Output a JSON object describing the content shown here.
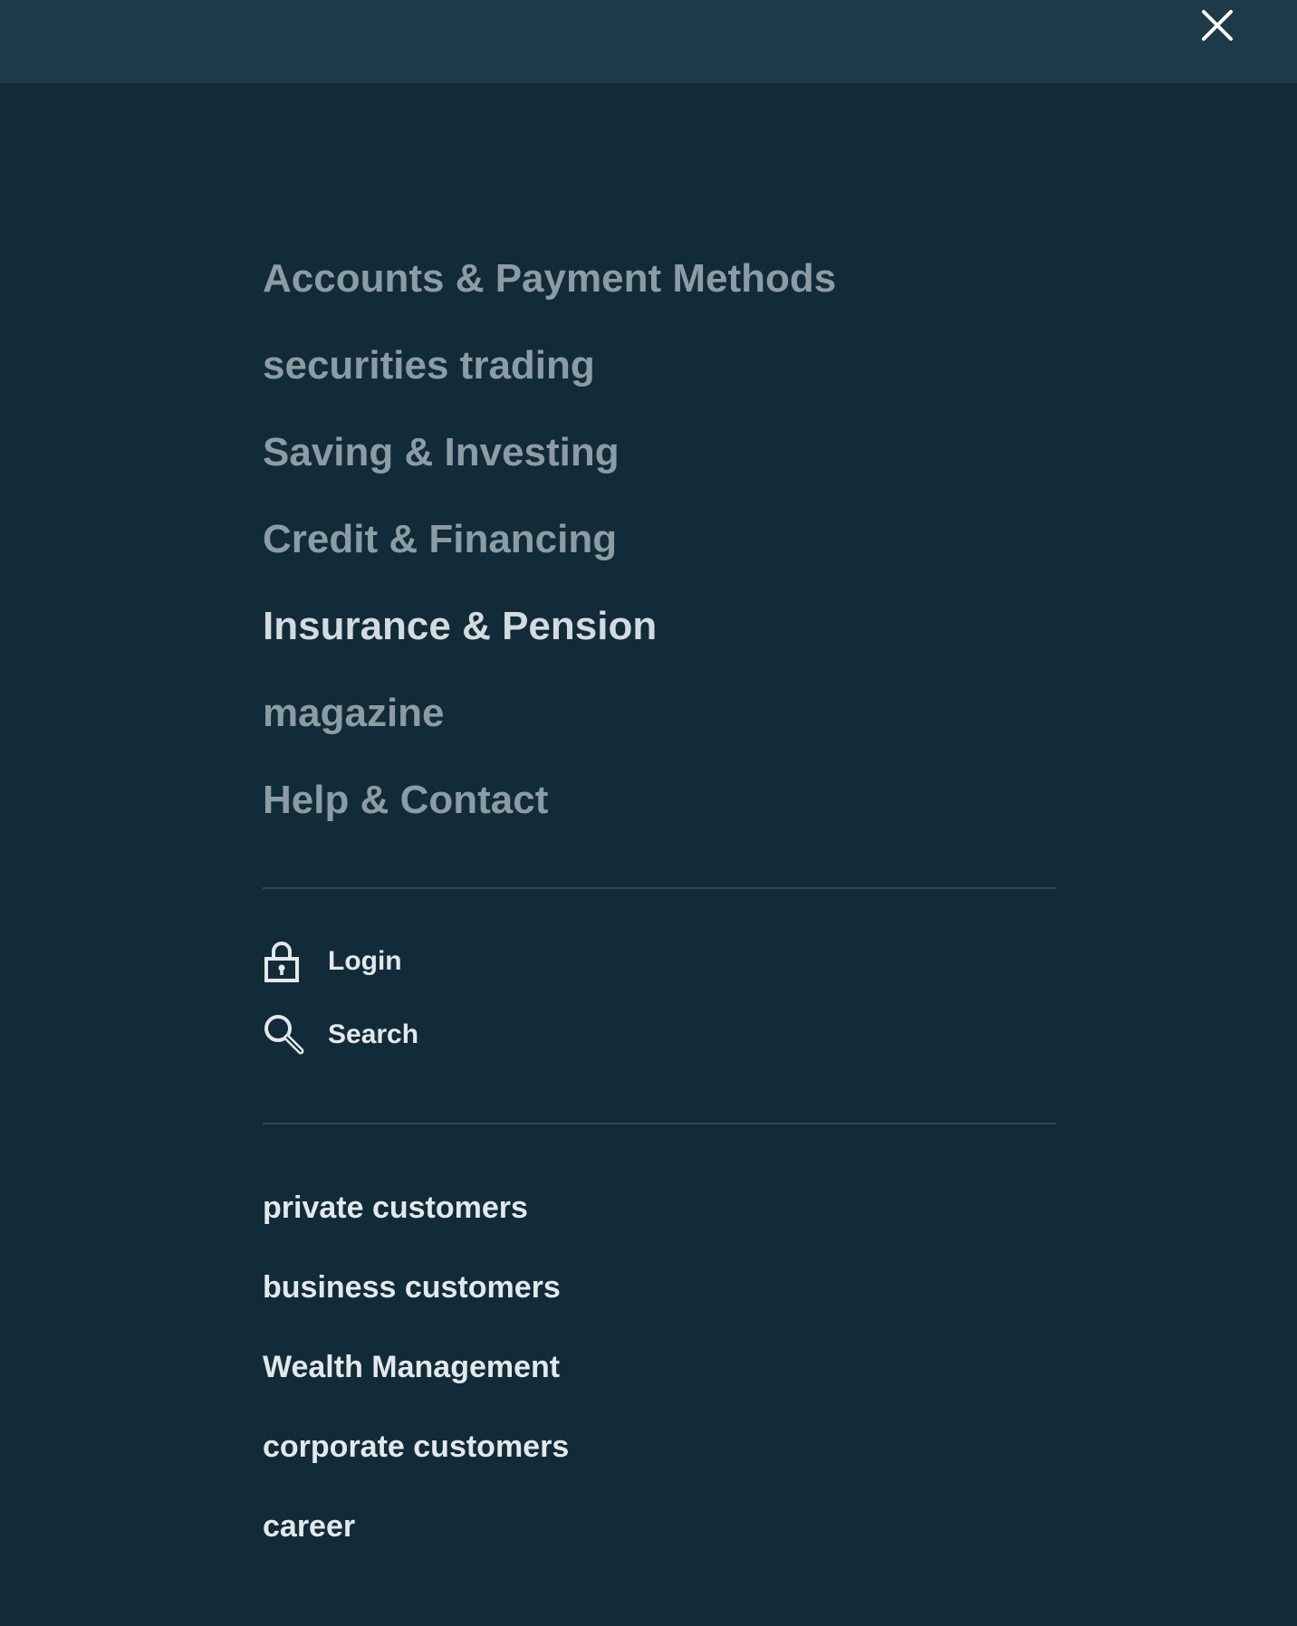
{
  "header": {
    "close_icon": "close-icon",
    "close_label": "Close menu"
  },
  "primary_nav": [
    {
      "label": "Accounts & Payment Methods",
      "active": false
    },
    {
      "label": "securities trading",
      "active": false
    },
    {
      "label": "Saving & Investing",
      "active": false
    },
    {
      "label": "Credit & Financing",
      "active": false
    },
    {
      "label": "Insurance & Pension",
      "active": true
    },
    {
      "label": "magazine",
      "active": false
    },
    {
      "label": "Help & Contact",
      "active": false
    }
  ],
  "utility_nav": [
    {
      "label": "Login",
      "icon": "lock-icon"
    },
    {
      "label": "Search",
      "icon": "search-icon"
    }
  ],
  "secondary_nav": [
    {
      "label": "private customers"
    },
    {
      "label": "business customers"
    },
    {
      "label": "Wealth Management"
    },
    {
      "label": "corporate customers"
    },
    {
      "label": "career"
    }
  ],
  "colors": {
    "background": "#112b39",
    "topbar": "#1d3a48",
    "primary_text": "#8c9ca4",
    "primary_text_active": "#d4dbdf",
    "secondary_text": "#e3e8eb",
    "divider": "#2f4653"
  }
}
